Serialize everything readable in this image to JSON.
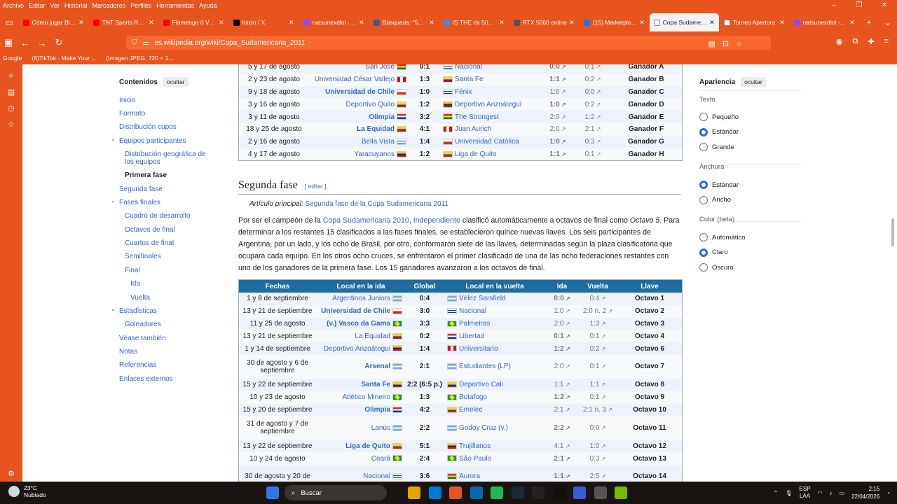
{
  "menubar": [
    "Archivo",
    "Editar",
    "Ver",
    "Historial",
    "Marcadores",
    "Perfiles",
    "Herramientas",
    "Ayuda"
  ],
  "tabs": [
    {
      "title": "Cómo jugar Blood",
      "color": "#ff0000"
    },
    {
      "title": "TNT Sports Replay",
      "color": "#ff0000"
    },
    {
      "title": "Flamengo 0 Vs 4",
      "color": "#ff0000"
    },
    {
      "title": "Inicio / X",
      "color": "#000000"
    },
    {
      "title": "natsunexdlol - Tw",
      "color": "#9146ff"
    },
    {
      "title": "Búsqueda: \"5060",
      "color": "#3b5998"
    },
    {
      "title": "IS THE rtx 5060 ti",
      "color": "#4285f4"
    },
    {
      "title": "RTX 5060 online",
      "color": "#555555"
    },
    {
      "title": "(15) Marketplace",
      "color": "#1877f2"
    },
    {
      "title": "Copa Sudamericana",
      "color": "#ffffff",
      "active": true
    },
    {
      "title": "Torneo Apertura",
      "color": "#ffffff"
    },
    {
      "title": "natsunexdlol - Tw",
      "color": "#9146ff"
    }
  ],
  "url": "es.wikipedia.org/wiki/Copa_Sudamericana_2011",
  "bookmarks": [
    "Google",
    "(6)TikTok - Make Your ...",
    "(Imagen JPEG, 720 × 1..."
  ],
  "toc": {
    "title": "Contenidos",
    "hide": "ocultar",
    "items": [
      "Inicio",
      "Formato",
      "Distribución cupos",
      "Equipos participantes",
      "Distribución geográfica de los equipos",
      "Primera fase",
      "Segunda fase",
      "Fases finales",
      "Cuadro de desarrollo",
      "Octavos de final",
      "Cuartos de final",
      "Semifinales",
      "Final",
      "Ida",
      "Vuelta",
      "Estadísticas",
      "Goleadores",
      "Véase también",
      "Notas",
      "Referencias",
      "Enlaces externos"
    ]
  },
  "table1": [
    [
      "5 y 17 de agosto",
      "San José",
      "bo",
      "0:1",
      "Nacional",
      "uy",
      "0:0",
      "0:1",
      "Ganador A"
    ],
    [
      "2 y 23 de agosto",
      "Universidad César Vallejo",
      "pe",
      "1:3",
      "Santa Fe",
      "co",
      "1:1",
      "0:2",
      "Ganador B"
    ],
    [
      "9 y 18 de agosto",
      "Universidad de Chile",
      "ch",
      "1:0",
      "Fénix",
      "uy",
      "1:0",
      "0:0",
      "Ganador C"
    ],
    [
      "3 y 16 de agosto",
      "Deportivo Quito",
      "ec",
      "1:2",
      "Deportivo Anzoátegui",
      "ve",
      "1:0",
      "0:2",
      "Ganador D"
    ],
    [
      "3 y 11 de agosto",
      "Olimpia",
      "py",
      "3:2",
      "The Strongest",
      "bo",
      "2:0",
      "1:2",
      "Ganador E"
    ],
    [
      "18 y 25 de agosto",
      "La Equidad",
      "co",
      "4:1",
      "Juan Aurich",
      "pe",
      "2:0",
      "2:1",
      "Ganador F"
    ],
    [
      "2 y 16 de agosto",
      "Bella Vista",
      "uy",
      "1:4",
      "Universidad Católica",
      "ch",
      "1:0",
      "0:3",
      "Ganador G"
    ],
    [
      "4 y 17 de agosto",
      "Yaracuyanos",
      "ve",
      "1:2",
      "Liga de Quito",
      "ec",
      "1:1",
      "0:1",
      "Ganador H"
    ]
  ],
  "section": {
    "title": "Segunda fase",
    "edit": "editar",
    "main_label": "Artículo principal:",
    "main_link": "Segunda fase de la Copa Sudamericana 2011"
  },
  "paragraph": {
    "p1": "Por ser el campeón de la ",
    "l1": "Copa Sudamericana 2010",
    "p2": ", ",
    "l2": "Independiente",
    "p3": " clasificó automáticamente a octavos de final como ",
    "i1": "Octavo 5",
    "p4": ". Para determinar a los restantes 15 clasificados a las fases finales, se establecieron quince nuevas llaves. Los seis participantes de Argentina, por un lado, y los ocho de Brasil, por otro, conformaron siete de las llaves, determinadas según la plaza clasificatoria que ocupara cada equipo. En los otros ocho cruces, se enfrentaron el primer clasificado de una de las ocho federaciones restantes con uno de los ganadores de la primera fase. Los 15 ganadores avanzaron a los octavos de final."
  },
  "table2_headers": [
    "Fechas",
    "Local en la ida",
    "Global",
    "Local en la vuelta",
    "Ida",
    "Vuelta",
    "Llave"
  ],
  "table2": [
    [
      "1 y 8 de septiembre",
      "Argentinos Juniors",
      "ar",
      "0:4",
      "Vélez Sarsfield",
      "ar",
      "0:0",
      "0:4",
      "Octavo 1"
    ],
    [
      "13 y 21 de septiembre",
      "Universidad de Chile",
      "ch",
      "3:0",
      "Nacional",
      "uy",
      "1:0",
      "2:0 n. 2",
      "Octavo 2"
    ],
    [
      "11 y 25 de agosto",
      "(v.) Vasco da Gama",
      "br",
      "3:3",
      "Palmeiras",
      "br",
      "2:0",
      "1:3",
      "Octavo 3"
    ],
    [
      "13 y 21 de septiembre",
      "La Equidad",
      "co",
      "0:2",
      "Libertad",
      "py",
      "0:1",
      "0:1",
      "Octavo 4"
    ],
    [
      "1 y 14 de septiembre",
      "Deportivo Anzoátegui",
      "ve",
      "1:4",
      "Universitario",
      "pe",
      "1:2",
      "0:2",
      "Octavo 6"
    ],
    [
      "30 de agosto y 6 de septiembre",
      "Arsenal",
      "ar",
      "2:1",
      "Estudiantes (LP)",
      "ar",
      "2:0",
      "0:1",
      "Octavo 7"
    ],
    [
      "15 y 22 de septiembre",
      "Santa Fe",
      "co",
      "2:2 (6:5 p.)",
      "Deportivo Cali",
      "co",
      "1:1",
      "1:1",
      "Octavo 8"
    ],
    [
      "10 y 23 de agosto",
      "Atlético Mineiro",
      "br",
      "1:3",
      "Botafogo",
      "br",
      "1:2",
      "0:1",
      "Octavo 9"
    ],
    [
      "15 y 20 de septiembre",
      "Olimpia",
      "py",
      "4:2",
      "Emelec",
      "ec",
      "2:1",
      "2:1 n. 3",
      "Octavo 10"
    ],
    [
      "31 de agosto y 7 de septiembre",
      "Lanús",
      "ar",
      "2:2",
      "Godoy Cruz (v.)",
      "ar",
      "2:2",
      "0:0",
      "Octavo 11"
    ],
    [
      "13 y 22 de septiembre",
      "Liga de Quito",
      "ec",
      "5:1",
      "Trujillanos",
      "ve",
      "4:1",
      "1:0",
      "Octavo 12"
    ],
    [
      "10 y 24 de agosto",
      "Ceará",
      "br",
      "2:4",
      "São Paulo",
      "br",
      "2:1",
      "0:3",
      "Octavo 13"
    ],
    [
      "30 de agosto y 20 de",
      "Nacional",
      "uy",
      "3:6",
      "Aurora",
      "bo",
      "1:1",
      "2:5",
      "Octavo 14"
    ]
  ],
  "appearance": {
    "title": "Apariencia",
    "hide": "ocultar",
    "text_label": "Texto",
    "text_opts": [
      "Pequeño",
      "Estándar",
      "Grande"
    ],
    "width_label": "Anchura",
    "width_opts": [
      "Estándar",
      "Ancho"
    ],
    "color_label": "Color (beta)",
    "color_opts": [
      "Automático",
      "Claro",
      "Oscuro"
    ]
  },
  "taskbar": {
    "temp": "23°C",
    "weather": "Nubiado",
    "search": "Buscar",
    "lang1": "ESP",
    "lang2": "LAA",
    "time": "2:15",
    "date": "22/04/2026"
  }
}
